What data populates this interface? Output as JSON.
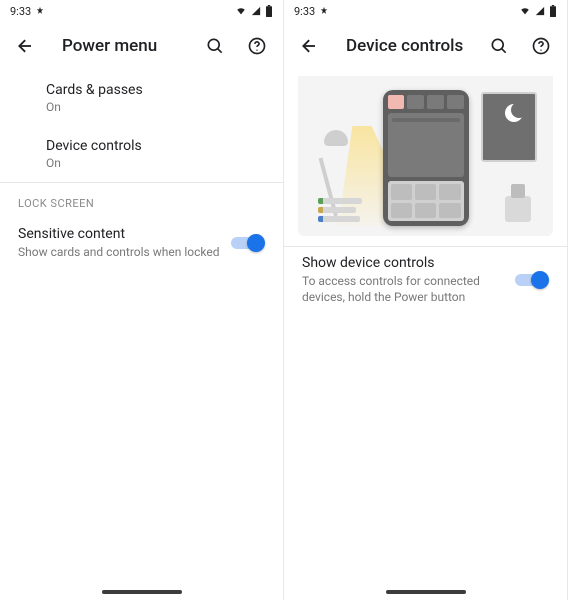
{
  "status": {
    "time": "9:33"
  },
  "left": {
    "title": "Power menu",
    "items": [
      {
        "label": "Cards & passes",
        "status": "On"
      },
      {
        "label": "Device controls",
        "status": "On"
      }
    ],
    "section_header": "LOCK SCREEN",
    "toggle": {
      "label": "Sensitive content",
      "description": "Show cards and controls when locked",
      "on": true
    }
  },
  "right": {
    "title": "Device controls",
    "toggle": {
      "label": "Show device controls",
      "description": "To access controls for connected devices, hold the Power button",
      "on": true
    }
  }
}
